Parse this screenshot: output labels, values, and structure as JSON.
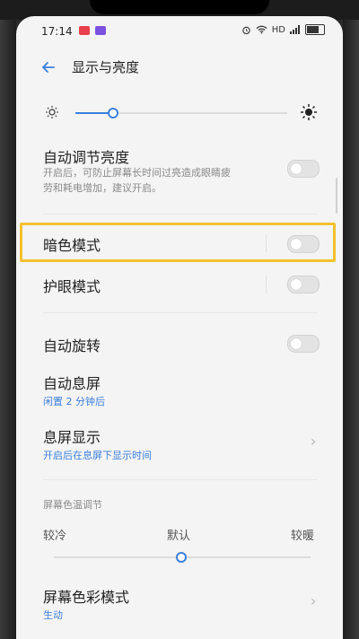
{
  "status_bar": {
    "time": "17:14",
    "network": "HD"
  },
  "header": {
    "title": "显示与亮度"
  },
  "brightness": {
    "level": 0.18
  },
  "settings": {
    "auto_brightness": {
      "title": "自动调节亮度",
      "description_line1": "开启后，可防止屏幕长时间过亮造成眼睛疲",
      "description_line2": "劳和耗电增加，建议开启。",
      "enabled": false
    },
    "dark_mode": {
      "title": "暗色模式",
      "enabled": false
    },
    "eye_protection": {
      "title": "护眼模式",
      "enabled": false
    },
    "auto_rotate": {
      "title": "自动旋转",
      "enabled": false
    },
    "auto_lock": {
      "title": "自动息屏",
      "value": "闲置 2 分钟后"
    },
    "screen_off_display": {
      "title": "息屏显示",
      "value": "开启后在息屏下显示时间"
    },
    "color_temperature": {
      "section_title": "屏幕色温调节",
      "cold_label": "较冷",
      "default_label": "默认",
      "warm_label": "较暖",
      "level": 0.5
    },
    "color_mode": {
      "title": "屏幕色彩模式",
      "value": "生动"
    }
  },
  "colors": {
    "accent": "#3b7fdc",
    "highlight": "#f2c12e"
  }
}
